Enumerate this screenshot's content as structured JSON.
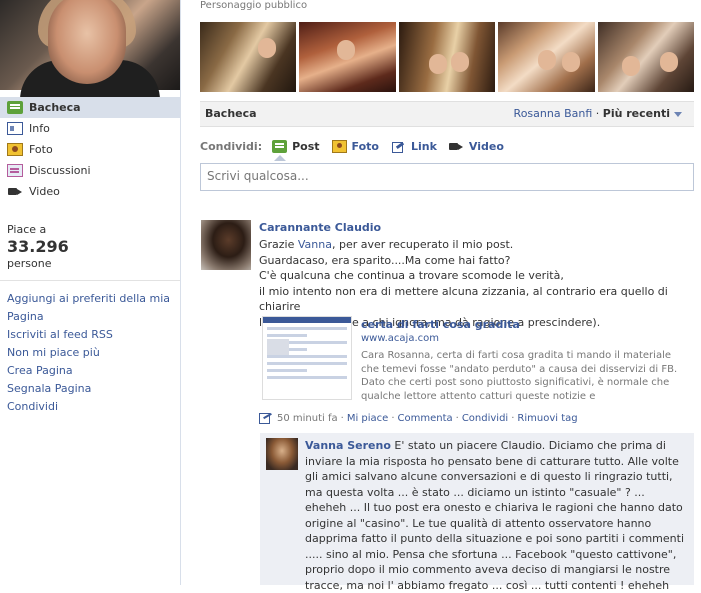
{
  "nav": {
    "items": [
      {
        "label": "Bacheca",
        "icon": "wall-icon",
        "active": true
      },
      {
        "label": "Info",
        "icon": "info-icon"
      },
      {
        "label": "Foto",
        "icon": "photo-icon"
      },
      {
        "label": "Discussioni",
        "icon": "discussion-icon"
      },
      {
        "label": "Video",
        "icon": "video-icon"
      }
    ]
  },
  "likes": {
    "label": "Piace a",
    "count": "33.296",
    "unit": "persone"
  },
  "actions": [
    "Aggiungi ai preferiti della mia Pagina",
    "Iscriviti al feed RSS",
    "Non mi piace più",
    "Crea Pagina",
    "Segnala Pagina",
    "Condividi"
  ],
  "main": {
    "category": "Personaggio pubblico"
  },
  "wall_bar": {
    "title": "Bacheca",
    "filter_owner": "Rosanna Banfi",
    "separator": " · ",
    "filter_sort": "Più recenti"
  },
  "share": {
    "label": "Condividi:",
    "options": [
      {
        "label": "Post",
        "icon": "post-icon"
      },
      {
        "label": "Foto",
        "icon": "photo-icon"
      },
      {
        "label": "Link",
        "icon": "link-icon"
      },
      {
        "label": "Video",
        "icon": "video-icon"
      }
    ]
  },
  "composer": {
    "placeholder": "Scrivi qualcosa..."
  },
  "story": {
    "author": "Carannante Claudio",
    "lines": [
      {
        "pre": "Grazie ",
        "link": "Vanna",
        "post": ", per aver recuperato il mio post."
      },
      {
        "pre": "Guardacaso, era sparito....Ma come hai fatto?"
      },
      {
        "pre": "C'è qualcuna che continua a trovare scomode le verità,"
      },
      {
        "pre": "il mio intento non era di mettere alcuna zizzania, al contrario era quello di chiarire"
      },
      {
        "pre": "l'accaduto (specie a chi ignora, ma dà ragione a prescindere)."
      }
    ],
    "attachment": {
      "title": "certa di farti cosa gradita",
      "domain": "www.acaja.com",
      "description": "Cara Rosanna, certa di farti cosa gradita ti mando il materiale che temevi fosse \"andato perduto\" a causa dei disservizi di FB. Dato che certi post sono piuttosto significativi, è normale che qualche lettore attento catturi queste notizie e"
    },
    "meta": {
      "time": "50 minuti fa",
      "dot": "·",
      "like": "Mi piace",
      "comment": "Commenta",
      "share": "Condividi",
      "remove_tag": "Rimuovi tag"
    }
  },
  "comment": {
    "author": "Vanna Sereno",
    "text": " E' stato un piacere Claudio. Diciamo che prima di inviare la mia risposta ho pensato bene di catturare tutto. Alle volte gli amici salvano alcune conversazioni e di questo li ringrazio tutti, ma questa volta ... è stato ... diciamo un istinto \"casuale\" ? ... eheheh ... Il tuo post era onesto e chiariva le ragioni che hanno dato origine al \"casino\". Le tue qualità di attento osservatore hanno dapprima fatto il punto della situazione e poi sono partiti i commenti ..... sino al mio. Pensa che sfortuna ... Facebook \"questo cattivone\", proprio dopo il mio commento aveva deciso di mangiarsi le nostre tracce, ma noi l' abbiamo fregato ... così ... tutti contenti ! eheheh"
  },
  "colors": {
    "link": "#3b5998",
    "nav_active_bg": "#d8dfea",
    "comment_bg": "#edeff4"
  }
}
